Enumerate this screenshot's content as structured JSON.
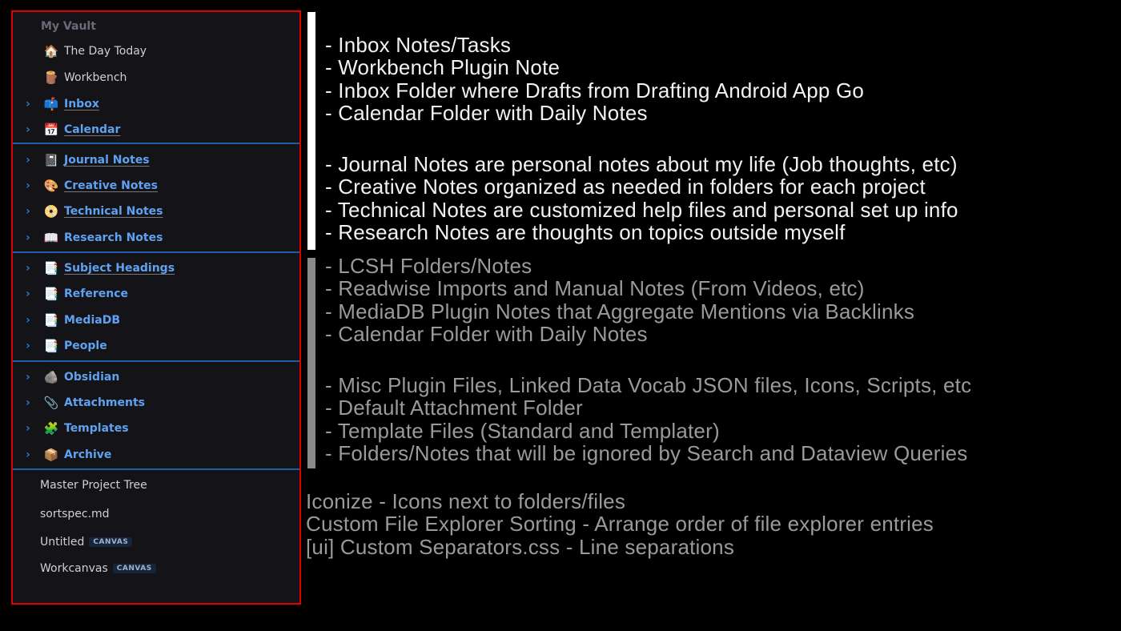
{
  "sidebar": {
    "vault_title": "My Vault",
    "items": [
      {
        "label": "The Day Today",
        "icon": "house-icon",
        "glyph": "🏠",
        "type": "file"
      },
      {
        "label": "Workbench",
        "icon": "log-icon",
        "glyph": "🪵",
        "type": "file"
      },
      {
        "label": "Inbox",
        "icon": "mailbox-icon",
        "glyph": "📫",
        "type": "folder",
        "underlined": true
      },
      {
        "label": "Calendar",
        "icon": "calendar-icon",
        "glyph": "📅",
        "type": "folder",
        "underlined": true
      },
      {
        "label": "Journal Notes",
        "icon": "notebook-icon",
        "glyph": "📓",
        "type": "folder",
        "underlined": true
      },
      {
        "label": "Creative Notes",
        "icon": "palette-icon",
        "glyph": "🎨",
        "type": "folder",
        "underlined": true
      },
      {
        "label": "Technical Notes",
        "icon": "dvd-icon",
        "glyph": "📀",
        "type": "folder",
        "underlined": true
      },
      {
        "label": "Research Notes",
        "icon": "open-book-icon",
        "glyph": "📖",
        "type": "folder"
      },
      {
        "label": "Subject Headings",
        "icon": "page-icon",
        "glyph": "📑",
        "type": "folder",
        "underlined": true
      },
      {
        "label": "Reference",
        "icon": "page-icon",
        "glyph": "📑",
        "type": "folder"
      },
      {
        "label": "MediaDB",
        "icon": "page-icon",
        "glyph": "📑",
        "type": "folder"
      },
      {
        "label": "People",
        "icon": "page-icon",
        "glyph": "📑",
        "type": "folder"
      },
      {
        "label": "Obsidian",
        "icon": "rock-icon",
        "glyph": "🪨",
        "type": "folder"
      },
      {
        "label": "Attachments",
        "icon": "paperclip-icon",
        "glyph": "📎",
        "type": "folder"
      },
      {
        "label": "Templates",
        "icon": "puzzle-icon",
        "glyph": "🧩",
        "type": "folder"
      },
      {
        "label": "Archive",
        "icon": "package-icon",
        "glyph": "📦",
        "type": "folder"
      }
    ],
    "files": [
      {
        "label": "Master Project Tree"
      },
      {
        "label": "sortspec.md"
      },
      {
        "label": "Untitled",
        "badge": "CANVAS"
      },
      {
        "label": "Workcanvas",
        "badge": "CANVAS"
      }
    ]
  },
  "annotations": {
    "group1": [
      "- Inbox Notes/Tasks",
      "- Workbench Plugin Note",
      "- Inbox Folder where Drafts from Drafting Android App Go",
      "- Calendar Folder with Daily Notes"
    ],
    "group2": [
      "- Journal Notes are personal notes about my life (Job thoughts, etc)",
      "- Creative Notes organized as needed in folders for each project",
      "- Technical Notes are customized help files and personal set up info",
      "- Research Notes are thoughts on topics outside myself"
    ],
    "group3": [
      "- LCSH Folders/Notes",
      "- Readwise Imports and Manual Notes (From Videos, etc)",
      "- MediaDB Plugin Notes that Aggregate Mentions via Backlinks",
      "- Calendar Folder with Daily Notes"
    ],
    "group4": [
      "- Misc Plugin Files, Linked Data Vocab JSON files, Icons, Scripts, etc",
      "- Default Attachment Folder",
      "- Template Files (Standard and Templater)",
      "- Folders/Notes that will be ignored by Search and Dataview Queries"
    ],
    "plugins": [
      "Iconize - Icons next to folders/files",
      "Custom File Explorer Sorting - Arrange order of file explorer entries",
      "[ui] Custom Separators.css - Line separations"
    ]
  },
  "colors": {
    "highlight_border": "#e00000",
    "separator": "#1f5fa8",
    "folder_text": "#5ea2f0",
    "annotation_primary": "#f2f2f2",
    "annotation_secondary": "#9a9a9a"
  }
}
